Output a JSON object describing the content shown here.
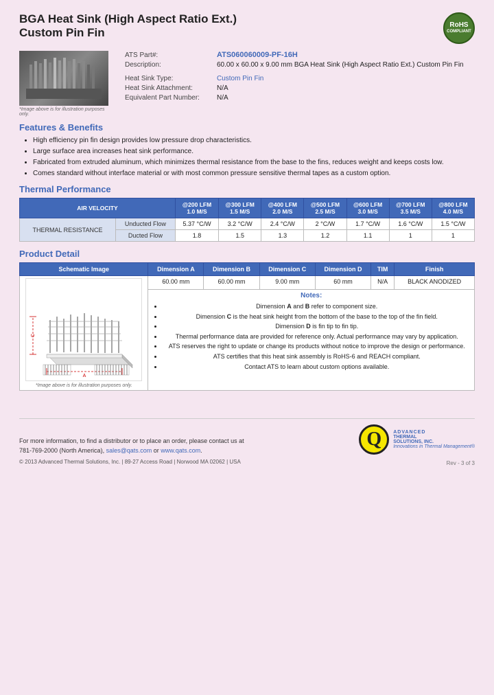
{
  "header": {
    "title_line1": "BGA Heat Sink (High Aspect Ratio Ext.)",
    "title_line2": "Custom Pin Fin",
    "rohs": "RoHS\nCOMPLIANT"
  },
  "specs": {
    "ats_part_label": "ATS Part#:",
    "ats_part_value": "ATS060060009-PF-16H",
    "description_label": "Description:",
    "description_value": "60.00 x 60.00 x 9.00 mm  BGA Heat Sink (High Aspect Ratio Ext.) Custom Pin Fin",
    "heat_sink_type_label": "Heat Sink Type:",
    "heat_sink_type_value": "Custom Pin Fin",
    "attachment_label": "Heat Sink Attachment:",
    "attachment_value": "N/A",
    "equiv_part_label": "Equivalent Part Number:",
    "equiv_part_value": "N/A",
    "image_caption": "*Image above is for illustration purposes only."
  },
  "features": {
    "section_title": "Features & Benefits",
    "items": [
      "High efficiency pin fin design provides low pressure drop characteristics.",
      "Large surface area increases heat sink performance.",
      "Fabricated from extruded aluminum, which minimizes thermal resistance from the base to the fins, reduces weight and keeps costs low.",
      "Comes standard without interface material or with most common pressure sensitive thermal tapes as a custom option."
    ]
  },
  "thermal_performance": {
    "section_title": "Thermal Performance",
    "col_header_left": "AIR VELOCITY",
    "columns": [
      "@200 LFM\n1.0 M/S",
      "@300 LFM\n1.5 M/S",
      "@400 LFM\n2.0 M/S",
      "@500 LFM\n2.5 M/S",
      "@600 LFM\n3.0 M/S",
      "@700 LFM\n3.5 M/S",
      "@800 LFM\n4.0 M/S"
    ],
    "row_group": "THERMAL RESISTANCE",
    "rows": [
      {
        "label": "Unducted Flow",
        "values": [
          "5.37 °C/W",
          "3.2 °C/W",
          "2.4 °C/W",
          "2 °C/W",
          "1.7 °C/W",
          "1.6 °C/W",
          "1.5 °C/W"
        ]
      },
      {
        "label": "Ducted Flow",
        "values": [
          "1.8",
          "1.5",
          "1.3",
          "1.2",
          "1.1",
          "1",
          "1"
        ]
      }
    ]
  },
  "product_detail": {
    "section_title": "Product Detail",
    "columns": [
      "Schematic Image",
      "Dimension A",
      "Dimension B",
      "Dimension C",
      "Dimension D",
      "TIM",
      "Finish"
    ],
    "values": [
      "60.00 mm",
      "60.00 mm",
      "9.00 mm",
      "60 mm",
      "N/A",
      "BLACK ANODIZED"
    ],
    "schematic_caption": "*Image above is for illustration purposes only.",
    "notes_title": "Notes:",
    "notes": [
      "Dimension A and B refer to component size.",
      "Dimension C is the heat sink height from the bottom of the base to the top of the fin field.",
      "Dimension D is fin tip to fin tip.",
      "Thermal performance data are provided for reference only. Actual performance may vary by application.",
      "ATS reserves the right to update or change its products without notice to improve the design or performance.",
      "ATS certifies that this heat sink assembly is RoHS-6 and REACH compliant.",
      "Contact ATS to learn about custom options available."
    ]
  },
  "footer": {
    "contact_text": "For more information, to find a distributor or to place an order, please contact us at",
    "phone": "781-769-2000 (North America)",
    "email": "sales@qats.com",
    "website": "www.qats.com",
    "copyright": "© 2013 Advanced Thermal Solutions, Inc. | 89-27 Access Road | Norwood MA  02062 | USA",
    "page_num": "Rev - 3 of 3",
    "ats_q": "Q",
    "ats_line1": "ADVANCED",
    "ats_line2": "THERMAL",
    "ats_line3": "SOLUTIONS, INC.",
    "ats_tagline": "Innovations in Thermal Management®"
  }
}
